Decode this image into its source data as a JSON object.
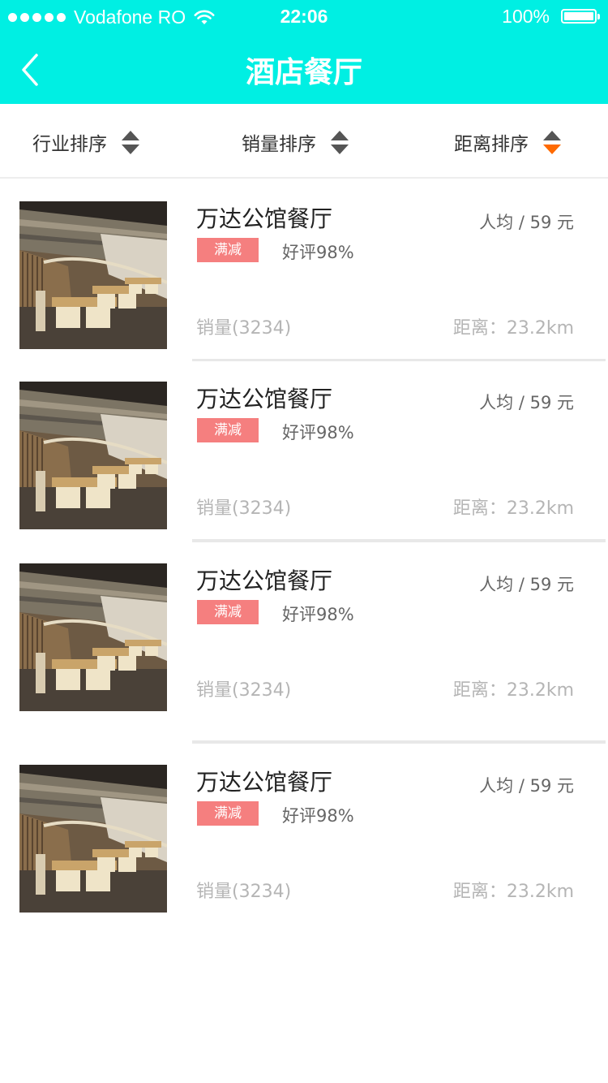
{
  "status_bar": {
    "carrier": "Vodafone RO",
    "time": "22:06",
    "battery": "100%"
  },
  "header": {
    "title": "酒店餐厅"
  },
  "sort": [
    {
      "label": "行业排序",
      "active": false
    },
    {
      "label": "销量排序",
      "active": false
    },
    {
      "label": "距离排序",
      "active": true
    }
  ],
  "colors": {
    "header": "#00efe3",
    "tag": "#f57f7f",
    "active_sort": "#ff6a00"
  },
  "items": [
    {
      "name": "万达公馆餐厅",
      "price": "人均 / 59 元",
      "tag": "满减",
      "rating": "好评98%",
      "sales": "销量(3234)",
      "distance": "距离：23.2km"
    },
    {
      "name": "万达公馆餐厅",
      "price": "人均 / 59 元",
      "tag": "满减",
      "rating": "好评98%",
      "sales": "销量(3234)",
      "distance": "距离：23.2km"
    },
    {
      "name": "万达公馆餐厅",
      "price": "人均 / 59 元",
      "tag": "满减",
      "rating": "好评98%",
      "sales": "销量(3234)",
      "distance": "距离：23.2km"
    },
    {
      "name": "万达公馆餐厅",
      "price": "人均 / 59 元",
      "tag": "满减",
      "rating": "好评98%",
      "sales": "销量(3234)",
      "distance": "距离：23.2km"
    }
  ]
}
